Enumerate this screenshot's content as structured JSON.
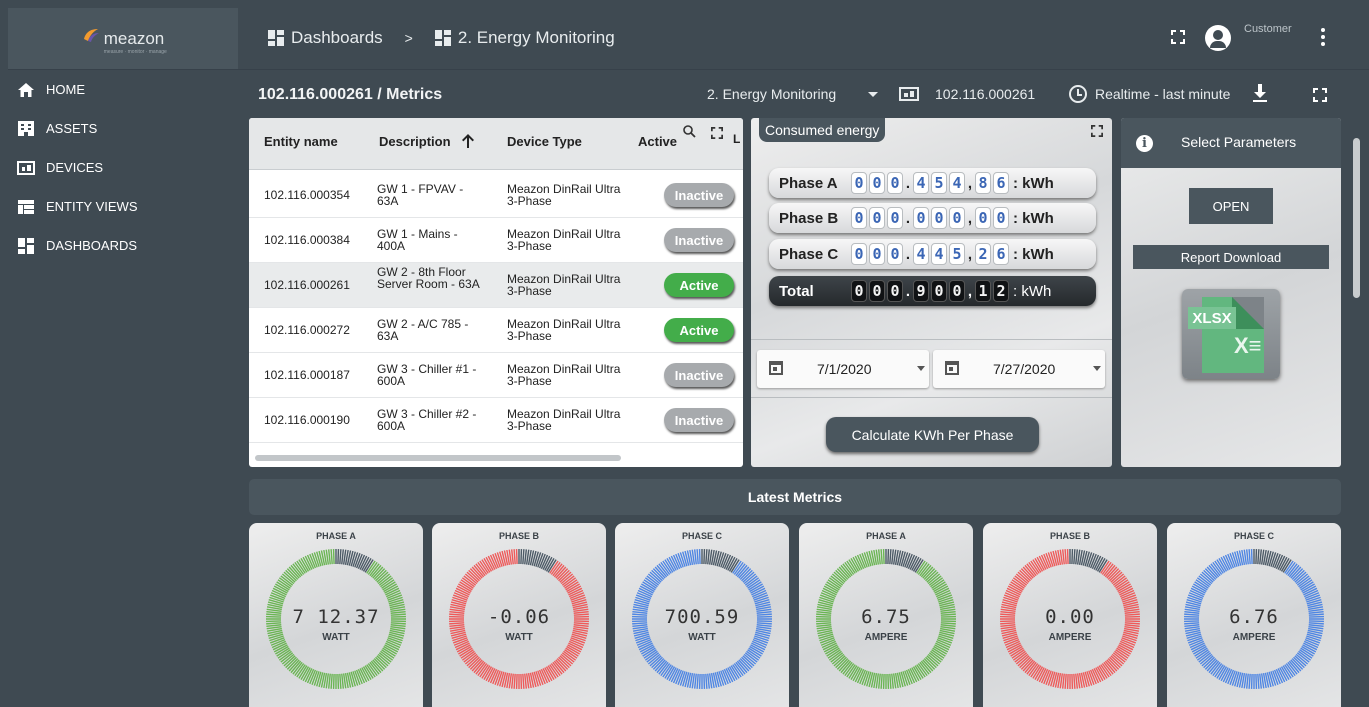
{
  "brand": {
    "logo_text": "meazon",
    "tagline": "measure · monitor · manage"
  },
  "sidebar": {
    "items": [
      {
        "label": "HOME",
        "icon": "home-icon"
      },
      {
        "label": "ASSETS",
        "icon": "assets-icon"
      },
      {
        "label": "DEVICES",
        "icon": "devices-icon"
      },
      {
        "label": "ENTITY VIEWS",
        "icon": "entity-views-icon"
      },
      {
        "label": "DASHBOARDS",
        "icon": "dashboards-icon"
      }
    ]
  },
  "header": {
    "breadcrumb": [
      "Dashboards",
      ">",
      "2. Energy Monitoring"
    ],
    "user_role": "Customer"
  },
  "subbar": {
    "title": "102.116.000261 / Metrics",
    "dashboard_state": "2. Energy Monitoring",
    "device": "102.116.000261",
    "timewindow": "Realtime - last minute"
  },
  "entities_table": {
    "columns": [
      "Entity name",
      "Description",
      "Device Type",
      "Active"
    ],
    "rows": [
      {
        "name": "102.116.000354",
        "description": "GW 1 - FPVAV - 63A",
        "type": "Meazon DinRail Ultra 3-Phase",
        "status": "Inactive"
      },
      {
        "name": "102.116.000384",
        "description": "GW 1 - Mains - 400A",
        "type": "Meazon DinRail Ultra 3-Phase",
        "status": "Inactive"
      },
      {
        "name": "102.116.000261",
        "description": "GW 2 - 8th Floor Server Room - 63A",
        "type": "Meazon DinRail Ultra 3-Phase",
        "status": "Active"
      },
      {
        "name": "102.116.000272",
        "description": "GW 2 - A/C 785 - 63A",
        "type": "Meazon DinRail Ultra 3-Phase",
        "status": "Active"
      },
      {
        "name": "102.116.000187",
        "description": "GW 3 - Chiller #1 - 600A",
        "type": "Meazon DinRail Ultra 3-Phase",
        "status": "Inactive"
      },
      {
        "name": "102.116.000190",
        "description": "GW 3 - Chiller #2 - 600A",
        "type": "Meazon DinRail Ultra 3-Phase",
        "status": "Inactive"
      }
    ]
  },
  "energy": {
    "title": "Consumed energy",
    "meters": [
      {
        "label": "Phase A",
        "digits": [
          "0",
          "0",
          "0",
          ".",
          "4",
          "5",
          "4",
          ",",
          "8",
          "6"
        ],
        "unit": ": kWh"
      },
      {
        "label": "Phase B",
        "digits": [
          "0",
          "0",
          "0",
          ".",
          "0",
          "0",
          "0",
          ",",
          "0",
          "0"
        ],
        "unit": ": kWh"
      },
      {
        "label": "Phase C",
        "digits": [
          "0",
          "0",
          "0",
          ".",
          "4",
          "4",
          "5",
          ",",
          "2",
          "6"
        ],
        "unit": ": kWh"
      },
      {
        "label": "Total",
        "digits": [
          "0",
          "0",
          "0",
          ".",
          "9",
          "0",
          "0",
          ",",
          "1",
          "2"
        ],
        "unit": ": kWh"
      }
    ],
    "date_from": "7/1/2020",
    "date_to": "7/27/2020",
    "calculate_label": "Calculate KWh Per Phase"
  },
  "params": {
    "title": "Select Parameters",
    "open_label": "OPEN",
    "report_label": "Report Download",
    "file_badge": "XLSX"
  },
  "latest_metrics": {
    "title": "Latest Metrics",
    "gauges": [
      {
        "phase": "PHASE A",
        "value": "7 12.37",
        "unit": "WATT",
        "color": "#6ab553"
      },
      {
        "phase": "PHASE B",
        "value": "-0.06",
        "unit": "WATT",
        "color": "#ee5a5a"
      },
      {
        "phase": "PHASE C",
        "value": "700.59",
        "unit": "WATT",
        "color": "#4f86e3"
      },
      {
        "phase": "PHASE A",
        "value": "6.75",
        "unit": "AMPERE",
        "color": "#6ab553"
      },
      {
        "phase": "PHASE B",
        "value": "0.00",
        "unit": "AMPERE",
        "color": "#ee5a5a"
      },
      {
        "phase": "PHASE C",
        "value": "6.76",
        "unit": "AMPERE",
        "color": "#4f86e3"
      }
    ],
    "indicator_color": "#4c5a66"
  }
}
